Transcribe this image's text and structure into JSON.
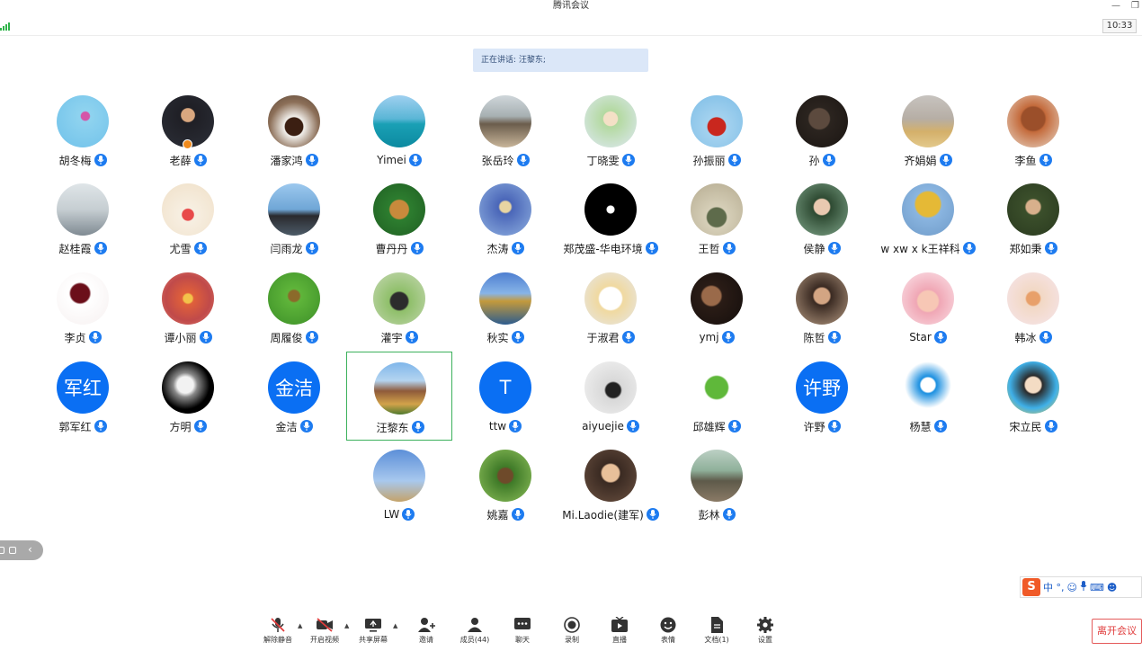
{
  "window": {
    "title": "腾讯会议",
    "clock": "10:33"
  },
  "speaker": {
    "label": "正在讲话: 汪黎东;"
  },
  "participants": [
    {
      "name": "胡冬梅",
      "bg": "radial-gradient(circle at 55% 40%, #d455a8 0 10%, #8fd3ef 12%, #6fc1ea 100%)"
    },
    {
      "name": "老薛",
      "bg": "radial-gradient(circle at 50% 38%, #d9a77f 0 16%, #1f1f25 18%, #2c2f38 100%)",
      "host": true
    },
    {
      "name": "潘家鸿",
      "bg": "radial-gradient(circle at 50% 60%, #3b1f12 0 22%, #f2f0ec 24%, #8c6f58 60%, #5a4535 100%)"
    },
    {
      "name": "Yimei",
      "bg": "linear-gradient(180deg, #9fd0f0 0%, #5ab6d6 45%, #1aa0b5 55%, #0c8aa0 100%)"
    },
    {
      "name": "张岳玲",
      "bg": "linear-gradient(180deg, #cfd6da 0%, #a7b0b2 40%, #6b5d4c 55%, #c8b59a 100%)"
    },
    {
      "name": "丁晓雯",
      "bg": "radial-gradient(circle at 50% 45%, #f4e0c6 0 18%, #b3d9a0 20%, #dfe9f4 100%)"
    },
    {
      "name": "孙振丽",
      "bg": "radial-gradient(circle at 50% 60%, #c9271e 0 22%, #a4d2ef 24%, #7dbde6 100%)"
    },
    {
      "name": "孙",
      "bg": "radial-gradient(circle at 45% 45%, #5c4a3e 0 25%, #2b241f 28%, #1a1512 100%)"
    },
    {
      "name": "齐娟娟",
      "bg": "linear-gradient(180deg, #c7c3bf 0%, #b6aea5 45%, #d4b06a 70%, #e3c98c 100%)"
    },
    {
      "name": "李鱼",
      "bg": "radial-gradient(circle at 50% 45%, #9b4f2a 0 30%, #c46b3c 34%, #e8d7c8 100%)"
    },
    {
      "name": "赵桂霞",
      "bg": "linear-gradient(180deg, #dfe5e8 0%, #c6ced2 50%, #7f8a92 100%)"
    },
    {
      "name": "尤雪",
      "bg": "radial-gradient(circle at 50% 60%, #e84a4a 0 14%, #f7efe2 16%, #f0e0c8 100%)"
    },
    {
      "name": "闫雨龙",
      "bg": "linear-gradient(180deg, #9cc8ee 0%, #6fa6d6 50%, #2a2a2e 62%, #4c5b68 100%)"
    },
    {
      "name": "曹丹丹",
      "bg": "radial-gradient(circle at 50% 50%, #c88a3c 0 25%, #2d7d2f 28%, #1f5f22 100%)"
    },
    {
      "name": "杰涛",
      "bg": "radial-gradient(circle at 50% 45%, #e8d5a2 0 14%, #4a66b8 18%, #8fb0e0 100%)"
    },
    {
      "name": "郑茂盛-华电环境",
      "bg": "radial-gradient(circle at 50% 50%, #ffffff 0 10%, #000000 12%, #000000 100%)"
    },
    {
      "name": "王哲",
      "bg": "radial-gradient(circle at 50% 65%, #5e6b4b 0 22%, #d6cfb8 25%, #b5ab90 100%)"
    },
    {
      "name": "侯静",
      "bg": "radial-gradient(circle at 50% 45%, #e9c9b0 0 20%, #2e4a32 23%, #7fa58a 100%)"
    },
    {
      "name": "w xw x k王祥科",
      "bg": "radial-gradient(circle at 50% 40%, #e5b936 0 30%, #8ab5e0 34%, #6f9bc9 100%)"
    },
    {
      "name": "郑如秉",
      "bg": "radial-gradient(circle at 50% 45%, #d8b08c 0 18%, #3b4f2b 22%, #2a3a1f 100%)"
    },
    {
      "name": "李贞",
      "bg": "radial-gradient(circle at 45% 40%, #6b0f1a 0 22%, #ffffff 26%, #f6f0f0 100%)"
    },
    {
      "name": "谭小丽",
      "bg": "radial-gradient(circle at 50% 50%, #f3c24a 0 12%, #e0603a 16%, #c04a4a 60%, #e07a6a 100%)"
    },
    {
      "name": "周履俊",
      "bg": "radial-gradient(circle at 50% 45%, #8b6a2a 0 14%, #5fb53a 18%, #3c8f28 100%)"
    },
    {
      "name": "灌宇",
      "bg": "radial-gradient(circle at 50% 55%, #2c2c2c 0 22%, #8fbf6a 26%, #c7d9b4 100%)"
    },
    {
      "name": "秋实",
      "bg": "linear-gradient(180deg, #4e7fd0 0%, #87b4e8 40%, #c49a3c 55%, #2d5c8e 100%)"
    },
    {
      "name": "于淑君",
      "bg": "radial-gradient(circle at 50% 50%, #ffffff 0 30%, #f0d9a0 34%, #e6e6e6 100%)"
    },
    {
      "name": "ymj",
      "bg": "radial-gradient(circle at 40% 45%, #9a6a4a 0 22%, #2a1c16 26%, #140e0c 100%)"
    },
    {
      "name": "陈哲",
      "bg": "radial-gradient(circle at 50% 45%, #d3a583 0 20%, #3a2a22 24%, #b59a82 100%)"
    },
    {
      "name": "Star",
      "bg": "radial-gradient(circle at 50% 55%, #f7c7b5 0 26%, #f0a7b5 30%, #fbe4ea 100%)"
    },
    {
      "name": "韩冰",
      "bg": "radial-gradient(circle at 50% 50%, #e8a06a 0 18%, #f2d8c4 22%, #f6e5ec 100%)"
    },
    {
      "name": "郭军红",
      "text": "军红"
    },
    {
      "name": "方明",
      "bg": "radial-gradient(circle at 45% 45%, #f2f2f2 0 20%, #888 30%, #000 60%)"
    },
    {
      "name": "金洁",
      "text": "金洁"
    },
    {
      "name": "汪黎东",
      "bg": "linear-gradient(180deg, #7fb6ea 0%, #b4d4f0 35%, #8e5a3a 55%, #d2a24a 80%, #4f7a2e 100%)",
      "active": true
    },
    {
      "name": "ttw",
      "text": "T"
    },
    {
      "name": "aiyuejie",
      "bg": "radial-gradient(circle at 55% 55%, #222 0 18%, #d8d8d8 22%, #f4f4f4 100%)"
    },
    {
      "name": "邱雄辉",
      "bg": "radial-gradient(circle at 50% 50%, #5fb83a 0 30%, #ffffff 34%, #ffffff 100%)"
    },
    {
      "name": "许野",
      "text": "许野"
    },
    {
      "name": "杨慧",
      "bg": "radial-gradient(circle at 50% 45%, #ffffff 0 18%, #1a8fe0 22%, #ffffff 60%)"
    },
    {
      "name": "宋立民",
      "bg": "radial-gradient(circle at 50% 45%, #f4dcc4 0 20%, #2b2b2b 24%, #3fb0e8 60%, #f0c84a 100%)"
    },
    {
      "name": "LW",
      "bg": "linear-gradient(180deg, #5c8fd8 0%, #a8c8ee 60%, #c4a36a 100%)"
    },
    {
      "name": "姚嘉",
      "bg": "radial-gradient(circle at 50% 50%, #6e4a2a 0 20%, #3f7a28 24%, #8dbf5a 100%)"
    },
    {
      "name": "Mi.Laodie(建军)",
      "bg": "radial-gradient(circle at 50% 45%, #e8c09a 0 22%, #3a2a22 26%, #6a5040 100%)"
    },
    {
      "name": "彭林",
      "bg": "linear-gradient(180deg, #bcd0c4 0%, #8fb09a 40%, #5e5a4a 60%, #8a7a66 100%)"
    }
  ],
  "ime": {
    "text": "中 °,"
  },
  "toolbar": [
    {
      "label": "解除静音",
      "icon": "mic-muted-icon",
      "caret": true
    },
    {
      "label": "开启视频",
      "icon": "video-off-icon",
      "caret": true
    },
    {
      "label": "共享屏幕",
      "icon": "share-screen-icon",
      "caret": true
    },
    {
      "label": "邀请",
      "icon": "invite-icon"
    },
    {
      "label": "成员(44)",
      "icon": "members-icon"
    },
    {
      "label": "聊天",
      "icon": "chat-icon"
    },
    {
      "label": "录制",
      "icon": "record-icon"
    },
    {
      "label": "直播",
      "icon": "live-icon"
    },
    {
      "label": "表情",
      "icon": "emoji-icon"
    },
    {
      "label": "文档(1)",
      "icon": "document-icon"
    },
    {
      "label": "设置",
      "icon": "settings-icon"
    }
  ],
  "leave": {
    "label": "离开会议"
  },
  "colors": {
    "accent": "#1d7bf0",
    "active_border": "#3cb15c",
    "leave": "#e03b3b"
  }
}
